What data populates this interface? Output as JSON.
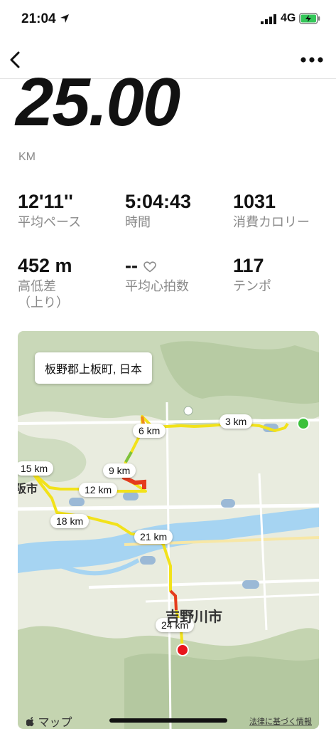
{
  "status_bar": {
    "time": "21:04",
    "network": "4G"
  },
  "summary": {
    "distance": "25.00",
    "unit": "KM"
  },
  "stats": [
    {
      "value": "12'11''",
      "label": "平均ペース"
    },
    {
      "value": "5:04:43",
      "label": "時間"
    },
    {
      "value": "1031",
      "label": "消費カロリー"
    },
    {
      "value": "452 m",
      "label": "高低差",
      "label2": "（上り）"
    },
    {
      "value": "--",
      "label": "平均心拍数"
    },
    {
      "value": "117",
      "label": "テンポ"
    }
  ],
  "map": {
    "location": "板野郡上板町, 日本",
    "km_markers": [
      "3 km",
      "6 km",
      "9 km",
      "12 km",
      "15 km",
      "18 km",
      "21 km",
      "24 km"
    ],
    "place_label": "吉野川市",
    "place_label_partial": "阪市",
    "attribution": "マップ",
    "legal": "法律に基づく情報"
  },
  "colors": {
    "start": "#3cc13c",
    "end": "#e8141c",
    "route_yellow": "#f2e21a",
    "route_red": "#e53a1e"
  },
  "icons": [
    "location-arrow-icon",
    "signal-icon",
    "battery-charging-icon",
    "back-chevron-icon",
    "more-icon",
    "heart-icon",
    "apple-logo-icon"
  ]
}
